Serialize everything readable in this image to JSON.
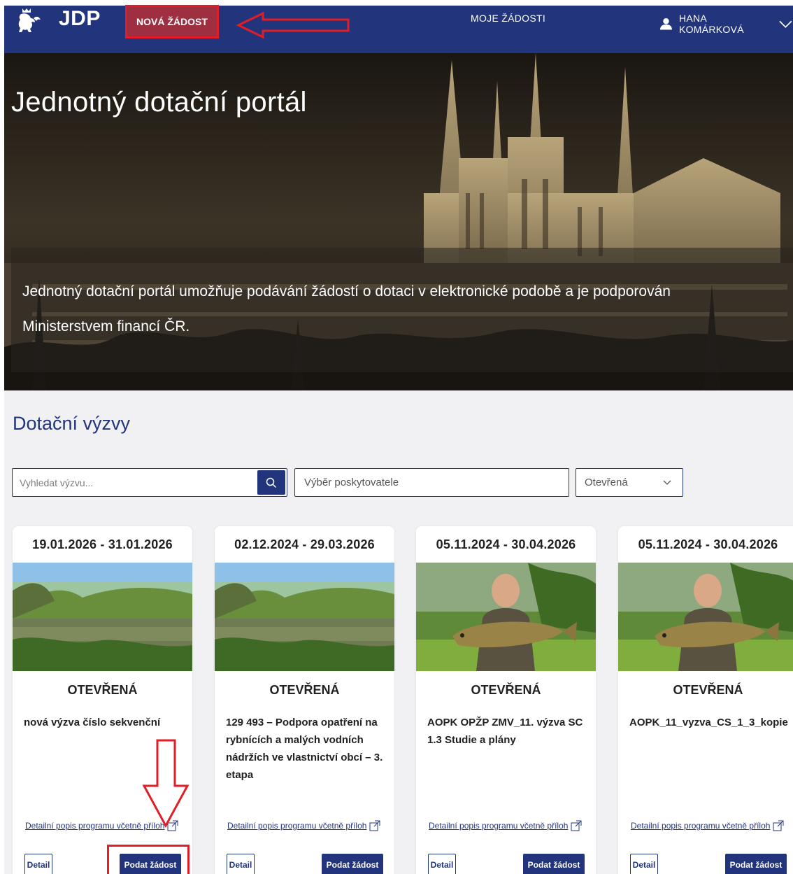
{
  "navbar": {
    "logo_text": "JDP",
    "new_request": "NOVÁ ŽÁDOST",
    "my_requests": "MOJE ŽÁDOSTI",
    "user_name": "HANA KOMÁRKOVÁ"
  },
  "hero": {
    "title": "Jednotný dotační portál",
    "description": "Jednotný dotační portál umožňuje podávání žádostí o dotaci v elektronické podobě a je podporován Ministerstvem financí ČR."
  },
  "section": {
    "title": "Dotační výzvy"
  },
  "filters": {
    "search_placeholder": "Vyhledat výzvu...",
    "provider_placeholder": "Výběr poskytovatele",
    "status_value": "Otevřená"
  },
  "cards": [
    {
      "date_range": "19.01.2026 - 31.01.2026",
      "image": "pond-landscape",
      "status": "OTEVŘENÁ",
      "name": "nová výzva číslo sekvenční",
      "link": "Detailní popis programu včetně příloh",
      "detail_label": "Detail",
      "submit_label": "Podat žádost"
    },
    {
      "date_range": "02.12.2024 - 29.03.2026",
      "image": "pond-landscape",
      "status": "OTEVŘENÁ",
      "name": "129 493 – Podpora opatření na rybnících a malých vodních nádržích ve vlastnictví obcí – 3. etapa",
      "link": "Detailní popis programu včetně příloh",
      "detail_label": "Detail",
      "submit_label": "Podat žádost"
    },
    {
      "date_range": "05.11.2024 - 30.04.2026",
      "image": "man-holding-carp",
      "status": "OTEVŘENÁ",
      "name": "AOPK OPŽP ZMV_11. výzva SC 1.3 Studie a plány",
      "link": "Detailní popis programu včetně příloh",
      "detail_label": "Detail",
      "submit_label": "Podat žádost"
    },
    {
      "date_range": "05.11.2024 - 30.04.2026",
      "image": "man-holding-carp",
      "status": "OTEVŘENÁ",
      "name": "AOPK_11_vyzva_CS_1_3_kopie",
      "link": "Detailní popis programu včetně příloh",
      "detail_label": "Detail",
      "submit_label": "Podat žádost"
    }
  ],
  "colors": {
    "navy": "#22357c",
    "highlight_button": "#9e2f41",
    "annotation_red": "#e21d26"
  }
}
